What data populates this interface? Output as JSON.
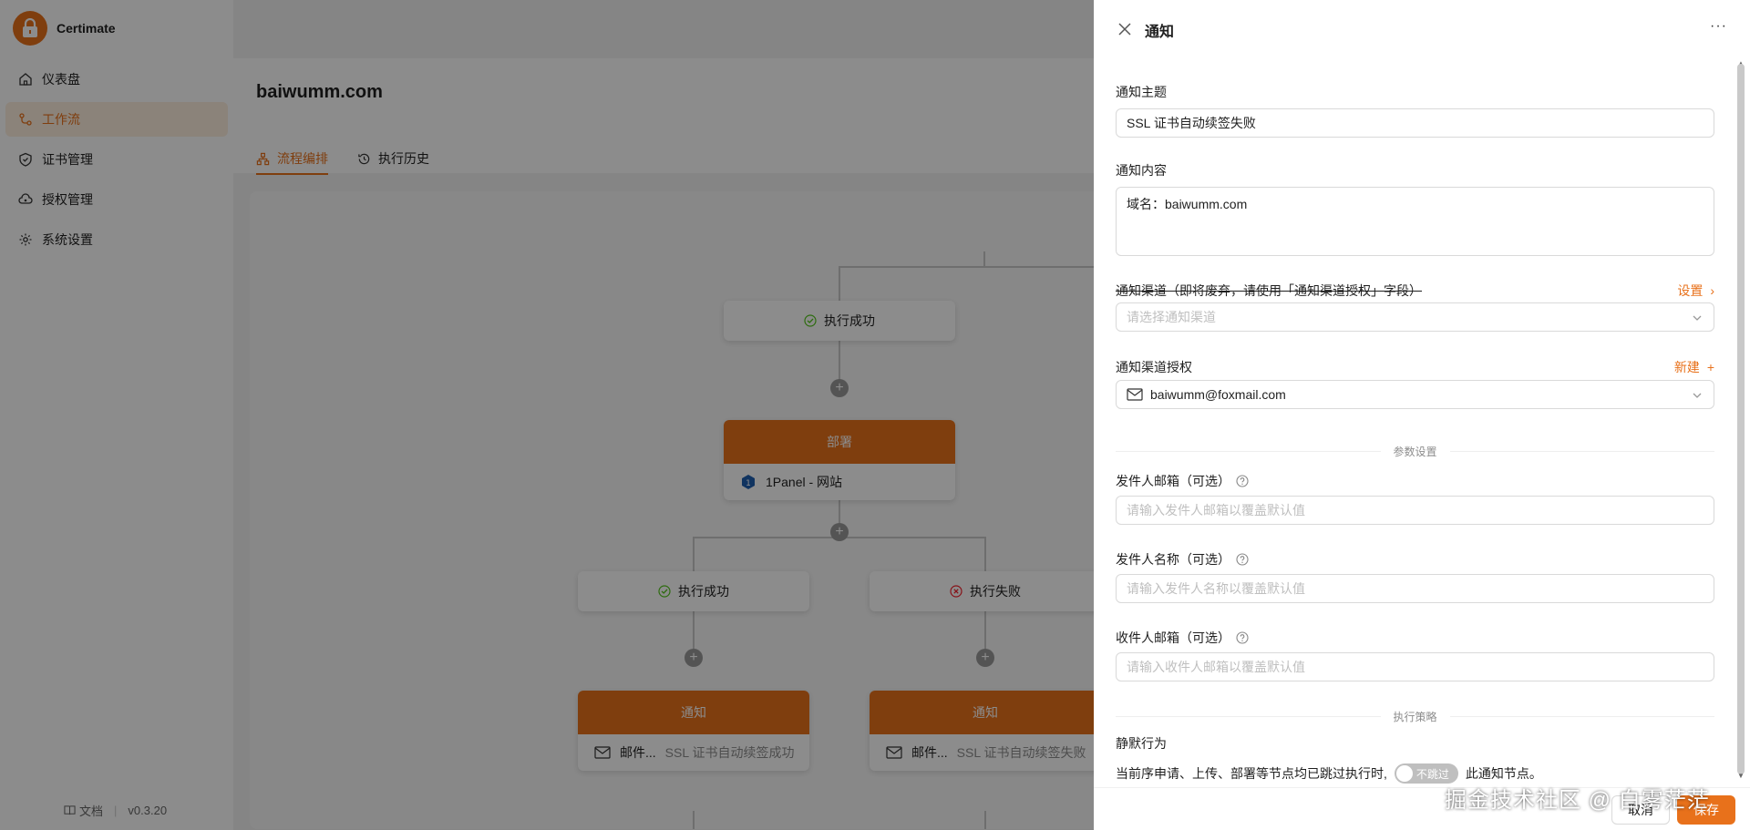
{
  "app": {
    "name": "Certimate",
    "version": "v0.3.20",
    "docs_label": "文档"
  },
  "colors": {
    "accent": "#e8711b",
    "success": "#52c41a",
    "error": "#f5222d"
  },
  "sidebar": {
    "items": [
      {
        "label": "仪表盘",
        "icon": "home-icon"
      },
      {
        "label": "工作流",
        "icon": "workflow-icon",
        "active": true
      },
      {
        "label": "证书管理",
        "icon": "shield-check-icon"
      },
      {
        "label": "授权管理",
        "icon": "cloud-key-icon"
      },
      {
        "label": "系统设置",
        "icon": "gear-icon"
      }
    ]
  },
  "main": {
    "title": "baiwumm.com",
    "tabs": [
      {
        "label": "流程编排",
        "icon": "flow-icon",
        "active": true
      },
      {
        "label": "执行历史",
        "icon": "history-icon"
      }
    ]
  },
  "flow": {
    "success_label": "执行成功",
    "fail_label": "执行失败",
    "deploy_head": "部署",
    "deploy_body": "1Panel - 网站",
    "notify_head": "通知",
    "notify_prefix": "邮件...",
    "notify_success_body": "SSL 证书自动续签成功",
    "notify_fail_body": "SSL 证书自动续签失败"
  },
  "drawer": {
    "title": "通知",
    "more_label": "···",
    "subject_label": "通知主题",
    "subject_value": "SSL 证书自动续签失败",
    "content_label": "通知内容",
    "content_value": "域名：baiwumm.com",
    "channel_label": "通知渠道（即将废弃，请使用「通知渠道授权」字段）",
    "channel_settings": "设置",
    "channel_placeholder": "请选择通知渠道",
    "access_label": "通知渠道授权",
    "access_new": "新建",
    "access_value": "baiwumm@foxmail.com",
    "params_divider": "参数设置",
    "sender_email_label": "发件人邮箱（可选）",
    "sender_email_placeholder": "请输入发件人邮箱以覆盖默认值",
    "sender_name_label": "发件人名称（可选）",
    "sender_name_placeholder": "请输入发件人名称以覆盖默认值",
    "recipient_label": "收件人邮箱（可选）",
    "recipient_placeholder": "请输入收件人邮箱以覆盖默认值",
    "strategy_divider": "执行策略",
    "silent_label": "静默行为",
    "silent_desc_prefix": "当前序申请、上传、部署等节点均已跳过执行时,",
    "silent_switch": "不跳过",
    "silent_desc_suffix": "此通知节点。",
    "cancel": "取消",
    "save": "保存"
  },
  "watermark": "掘金技术社区 @ 白雾茫茫"
}
